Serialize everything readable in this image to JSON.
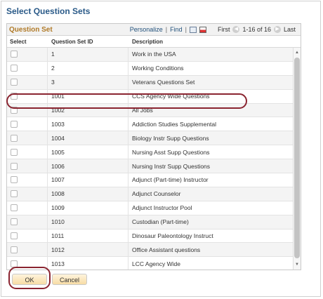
{
  "page": {
    "title": "Select Question Sets"
  },
  "grid": {
    "title": "Question Set",
    "nav": {
      "personalize": "Personalize",
      "separator": "|",
      "find": "Find",
      "first": "First",
      "range": "1-16 of 16",
      "last": "Last"
    },
    "columns": {
      "select": "Select",
      "id": "Question Set ID",
      "description": "Description"
    },
    "rows": [
      {
        "id": "1",
        "description": "Work in the USA"
      },
      {
        "id": "2",
        "description": "Working Conditions"
      },
      {
        "id": "3",
        "description": "Veterans Questions Set"
      },
      {
        "id": "1001",
        "description": "CCS Agency Wide Questions"
      },
      {
        "id": "1002",
        "description": "All Jobs"
      },
      {
        "id": "1003",
        "description": "Addiction Studies Supplemental"
      },
      {
        "id": "1004",
        "description": "Biology Instr Supp Questions"
      },
      {
        "id": "1005",
        "description": "Nursing Asst Supp Questions"
      },
      {
        "id": "1006",
        "description": "Nursing Instr Supp Questions"
      },
      {
        "id": "1007",
        "description": "Adjunct (Part-time) Instructor"
      },
      {
        "id": "1008",
        "description": "Adjunct Counselor"
      },
      {
        "id": "1009",
        "description": "Adjunct Instructor Pool"
      },
      {
        "id": "1010",
        "description": "Custodian (Part-time)"
      },
      {
        "id": "1011",
        "description": "Dinosaur Paleontology Instruct"
      },
      {
        "id": "1012",
        "description": "Office Assistant questions"
      },
      {
        "id": "1013",
        "description": "LCC Agency Wide"
      }
    ]
  },
  "buttons": {
    "ok": "OK",
    "cancel": "Cancel"
  },
  "colors": {
    "title": "#2a5a88",
    "grid_title": "#b07a28",
    "highlight": "#8a2430"
  }
}
